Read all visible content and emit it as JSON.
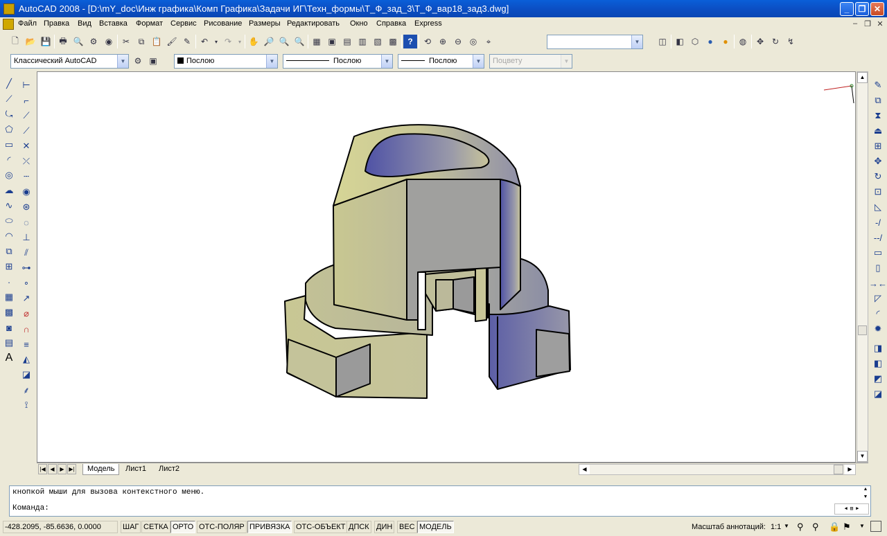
{
  "window": {
    "title": "AutoCAD 2008 - [D:\\mY_doc\\Инж графика\\Комп Графика\\Задачи ИГ\\Техн_формы\\Т_Ф_зад_3\\Т_Ф_вар18_зад3.dwg]"
  },
  "menu": [
    "Файл",
    "Правка",
    "Вид",
    "Вставка",
    "Формат",
    "Сервис",
    "Рисование",
    "Размеры",
    "Редактировать",
    "Окно",
    "Справка",
    "Express"
  ],
  "toolbar2": {
    "workspace": "Классический AutoCAD",
    "color": "Послою",
    "linetype": "Послою",
    "lineweight": "Послою",
    "plotstyle": "Поцвету"
  },
  "tabs": [
    "Модель",
    "Лист1",
    "Лист2"
  ],
  "command": {
    "history": "кнопкой мыши для вызова контекстного меню.",
    "prompt": "Команда:"
  },
  "status": {
    "coords": "-428.2095, -85.6636, 0.0000",
    "toggles": [
      "ШАГ",
      "СЕТКА",
      "ОРТО",
      "ОТС-ПОЛЯР",
      "ПРИВЯЗКА",
      "ОТС-ОБЪЕКТ",
      "ДПСК",
      "ДИН",
      "ВЕС",
      "МОДЕЛЬ"
    ],
    "annotation_label": "Масштаб аннотаций:",
    "annotation_scale": "1:1"
  },
  "colors": {
    "titlebar": "#0A5FD8",
    "model_face": "#C5C49A",
    "shade_blue": "#5A5FA8"
  }
}
